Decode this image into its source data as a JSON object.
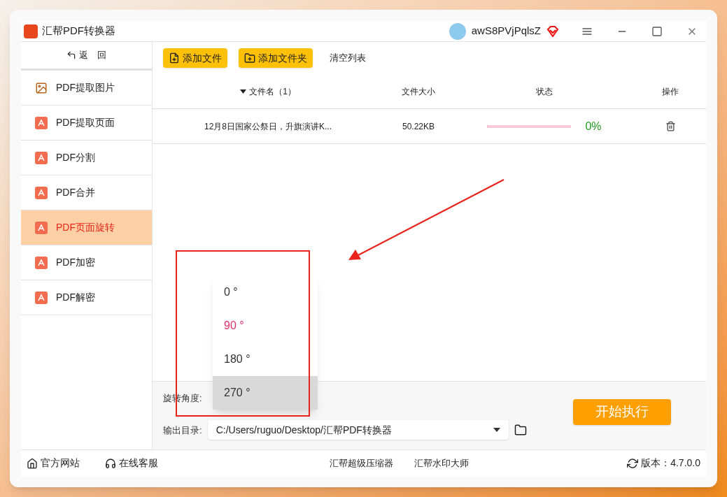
{
  "window": {
    "title": "汇帮PDF转换器",
    "user": "awS8PVjPqlsZ"
  },
  "sidebar": {
    "back": "返　回",
    "items": [
      {
        "label": "PDF提取图片",
        "kind": "image",
        "selected": false
      },
      {
        "label": "PDF提取页面",
        "kind": "pdf",
        "selected": false
      },
      {
        "label": "PDF分割",
        "kind": "pdf",
        "selected": false
      },
      {
        "label": "PDF合并",
        "kind": "pdf",
        "selected": false
      },
      {
        "label": "PDF页面旋转",
        "kind": "pdf",
        "selected": true
      },
      {
        "label": "PDF加密",
        "kind": "pdf",
        "selected": false
      },
      {
        "label": "PDF解密",
        "kind": "pdf",
        "selected": false
      }
    ]
  },
  "toolbar": {
    "add_file": "添加文件",
    "add_folder": "添加文件夹",
    "clear": "清空列表"
  },
  "table": {
    "columns": [
      "文件名（1）",
      "文件大小",
      "状态",
      "操作"
    ],
    "rows": [
      {
        "name": "12月8日国家公祭日，升旗演讲K...",
        "size": "50.22KB",
        "level": 0,
        "percent": "0%"
      }
    ]
  },
  "settings": {
    "angle_label": "旋转角度:",
    "output_label": "输出目录:",
    "output_value": "C:/Users/ruguo/Desktop/汇帮PDF转换器",
    "start": "开始执行"
  },
  "angle_dropdown": [
    {
      "label": "0 °",
      "selected": false,
      "hovered": false
    },
    {
      "label": "90 °",
      "selected": true,
      "hovered": false
    },
    {
      "label": "180 °",
      "selected": false,
      "hovered": false
    },
    {
      "label": "270 °",
      "selected": false,
      "hovered": true
    }
  ],
  "status_bar": {
    "website": "官方网站",
    "service": "在线客服",
    "links": [
      "汇帮超级压缩器",
      "汇帮水印大师"
    ],
    "version": "版本：4.7.0.0"
  }
}
